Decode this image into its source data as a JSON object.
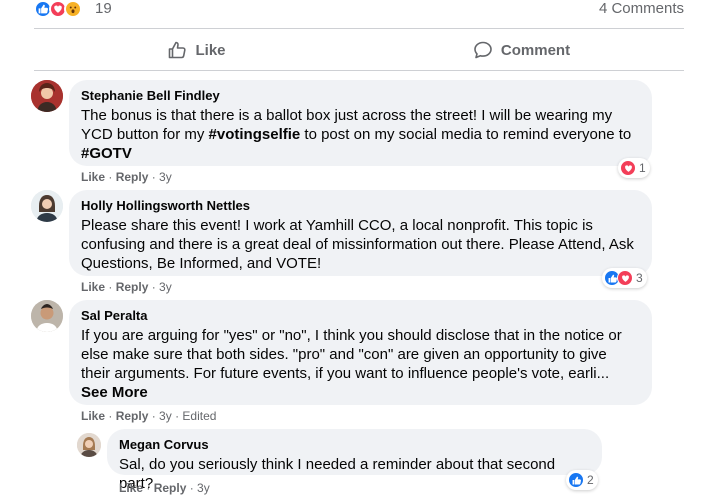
{
  "post": {
    "reaction_count": "19",
    "comments_count": "4 Comments",
    "like_label": "Like",
    "comment_label": "Comment"
  },
  "comments": [
    {
      "author": "Stephanie Bell Findley",
      "text_parts": [
        "The bonus is that there is a ballot box just across the street! I will be wearing my YCD button for my ",
        "#votingselfie",
        " to post on my social media to remind everyone to ",
        "#GOTV"
      ],
      "like": "Like",
      "reply": "Reply",
      "time": "3y",
      "reaction_count": "1"
    },
    {
      "author": "Holly Hollingsworth Nettles",
      "text": "Please share this event! I work at Yamhill CCO, a local nonprofit. This topic is confusing and there is a great deal of missinformation out there. Please Attend, Ask Questions, Be Informed, and VOTE!",
      "like": "Like",
      "reply": "Reply",
      "time": "3y",
      "reaction_count": "3"
    },
    {
      "author": "Sal Peralta",
      "text": "If you are arguing for \"yes\" or \"no\", I think you should disclose that in the notice or else make sure that both sides. \"pro\" and \"con\" are given an opportunity to give their arguments. For future events, if you want to influence people's vote, earli...",
      "see_more": "See More",
      "like": "Like",
      "reply": "Reply",
      "time": "3y",
      "edited": "Edited"
    },
    {
      "author": "Megan Corvus",
      "text": "Sal, do you seriously think I needed a reminder about that second part?",
      "like": "Like",
      "reply": "Reply",
      "time": "3y",
      "reaction_count": "2"
    }
  ],
  "colors": {
    "like_blue": "#1877f2",
    "love_red": "#f33e58",
    "wow_yellow": "#f7b125",
    "bubble_bg": "#f0f2f5",
    "meta_gray": "#65676b"
  }
}
